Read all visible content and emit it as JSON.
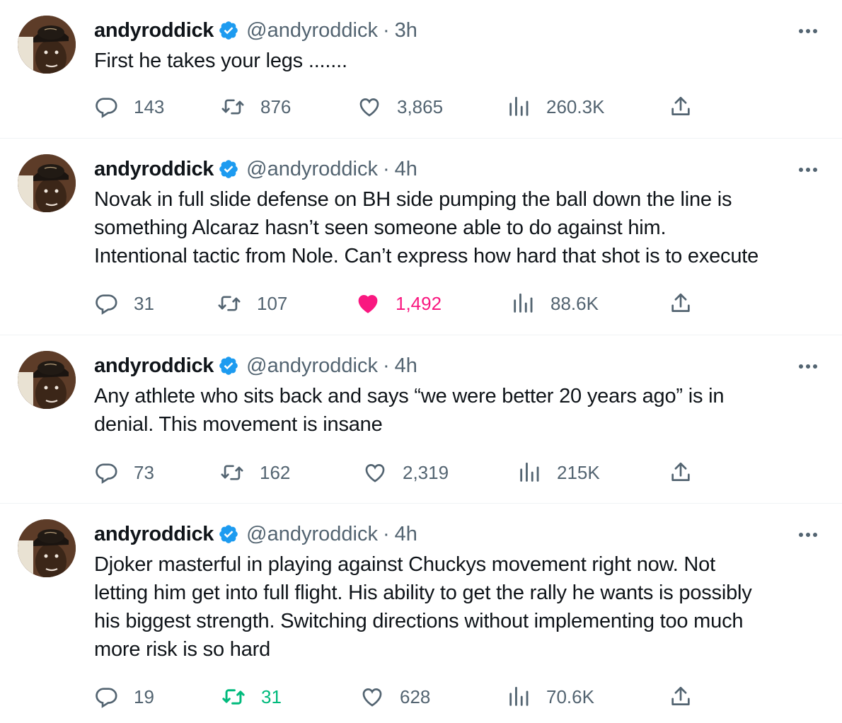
{
  "tweets": [
    {
      "name": "andyroddick",
      "handle": "@andyroddick",
      "separator": "·",
      "time": "3h",
      "lines": [
        "First he takes your legs ......."
      ],
      "replies": "143",
      "retweets": "876",
      "likes": "3,865",
      "views": "260.3K",
      "liked": false,
      "retweeted": false
    },
    {
      "name": "andyroddick",
      "handle": "@andyroddick",
      "separator": "·",
      "time": "4h",
      "lines": [
        "Novak in full slide defense on BH side pumping the ball down the line is",
        "something Alcaraz hasn’t seen someone able to do against him.",
        "Intentional tactic from Nole. Can’t express how hard that shot is to execute"
      ],
      "replies": "31",
      "retweets": "107",
      "likes": "1,492",
      "views": "88.6K",
      "liked": true,
      "retweeted": false
    },
    {
      "name": "andyroddick",
      "handle": "@andyroddick",
      "separator": "·",
      "time": "4h",
      "lines": [
        "Any athlete who sits back and says “we were better 20 years ago” is in",
        "denial. This movement is insane"
      ],
      "replies": "73",
      "retweets": "162",
      "likes": "2,319",
      "views": "215K",
      "liked": false,
      "retweeted": false
    },
    {
      "name": "andyroddick",
      "handle": "@andyroddick",
      "separator": "·",
      "time": "4h",
      "lines": [
        "Djoker masterful in playing against Chuckys movement right now. Not",
        "letting him get into full flight. His ability to get the rally he wants is possibly",
        "his biggest strength. Switching directions without implementing too much",
        "more risk is so hard"
      ],
      "replies": "19",
      "retweets": "31",
      "likes": "628",
      "views": "70.6K",
      "liked": false,
      "retweeted": true
    }
  ],
  "icons": {
    "reply": "reply-icon",
    "retweet": "retweet-icon",
    "like": "heart-icon",
    "views": "views-icon",
    "share": "share-icon",
    "verified": "verified-badge-icon",
    "more": "more-options-icon"
  },
  "colors": {
    "text": "#0f1419",
    "secondary": "#536471",
    "verified": "#1d9bf0",
    "like": "#f91880",
    "retweet": "#00ba7c",
    "divider": "#eff3f4"
  }
}
